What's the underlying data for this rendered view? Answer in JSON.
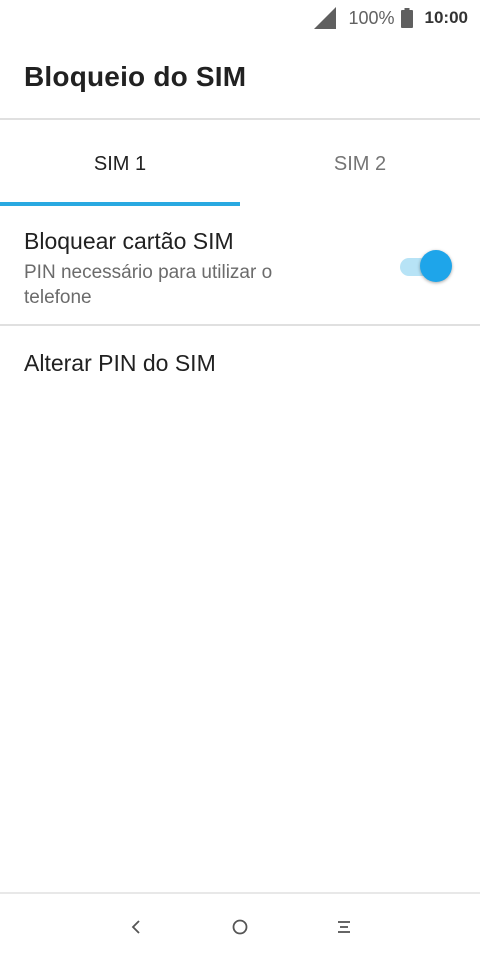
{
  "status_bar": {
    "battery_percent": "100%",
    "time": "10:00",
    "icons": [
      "signal-icon",
      "battery-icon"
    ]
  },
  "header": {
    "title": "Bloqueio do SIM"
  },
  "tabs": [
    {
      "label": "SIM 1",
      "selected": true
    },
    {
      "label": "SIM 2",
      "selected": false
    }
  ],
  "settings": [
    {
      "title": "Bloquear cartão SIM",
      "summary": "PIN necessário para utilizar o telefone",
      "toggle_on": true
    },
    {
      "title": "Alterar PIN do SIM"
    }
  ],
  "nav_bar": {
    "icons": [
      "back-icon",
      "home-icon",
      "menu-icon"
    ]
  },
  "colors": {
    "accent": "#29a9e1",
    "toggle_thumb": "#1ea5ea",
    "toggle_track": "#b7e3f6"
  }
}
